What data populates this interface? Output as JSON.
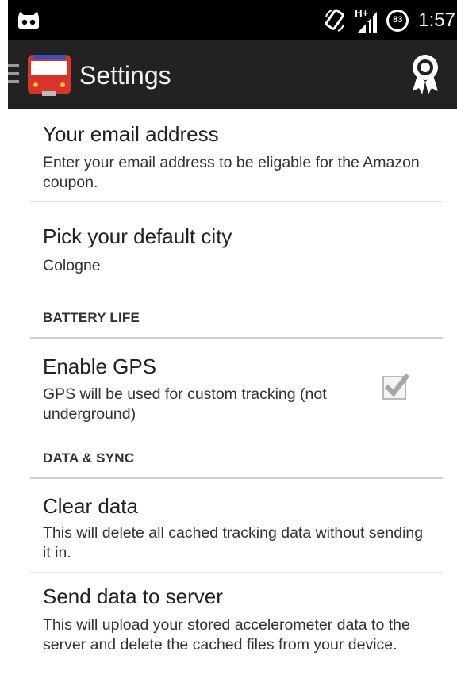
{
  "status_bar": {
    "time": "1:57",
    "battery_level": "83",
    "network_type": "H+",
    "left_icon": "android-bot-icon",
    "rotation_icon": "screen-rotation-icon",
    "signal_icon": "signal-icon"
  },
  "action_bar": {
    "title": "Settings",
    "drawer_icon": "menu-icon",
    "logo_icon": "bus-icon",
    "action_icon": "award-icon"
  },
  "preferences": {
    "email": {
      "title": "Your email address",
      "summary": "Enter your email address to be eligable for the Amazon coupon."
    },
    "city": {
      "title": "Pick your default city",
      "summary": "Cologne"
    },
    "battery_category": "BATTERY LIFE",
    "gps": {
      "title": "Enable GPS",
      "summary": "GPS will be used for custom tracking (not underground)",
      "checked": true
    },
    "data_category": "DATA & SYNC",
    "clear": {
      "title": "Clear data",
      "summary": "This will delete all cached tracking data without sending it in."
    },
    "send": {
      "title": "Send data to server",
      "summary": "This will upload your stored accelerometer data to the server and delete the cached files from your device."
    }
  },
  "colors": {
    "status_bar": "#000000",
    "action_bar": "#222222",
    "logo_red": "#d9342b",
    "logo_blue": "#2b56c9"
  }
}
